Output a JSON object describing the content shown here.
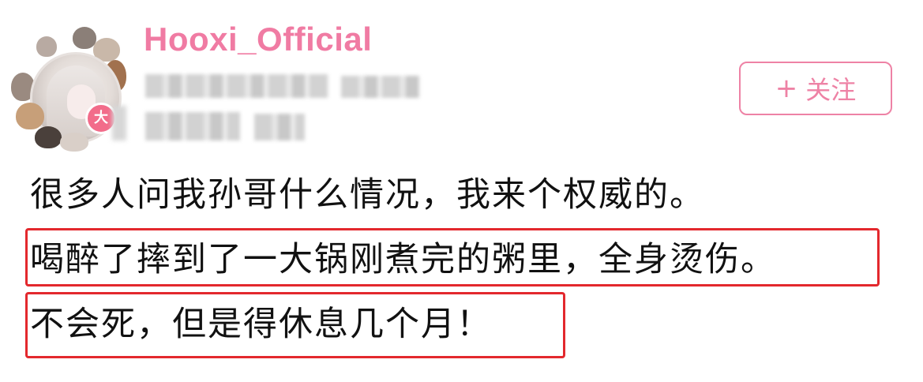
{
  "profile": {
    "username": "Hooxi_Official",
    "avatar_badge": "大"
  },
  "follow_button": {
    "plus": "+",
    "label": "关注"
  },
  "post": {
    "lines": [
      "很多人问我孙哥什么情况，我来个权威的。",
      "喝醉了摔到了一大锅刚煮完的粥里，全身烫伤。",
      "不会死，但是得休息几个月！"
    ]
  },
  "colors": {
    "username": "#f07ba3",
    "follow_border": "#ee82a5",
    "highlight_box": "#e3282d",
    "badge": "#f26c8a"
  }
}
